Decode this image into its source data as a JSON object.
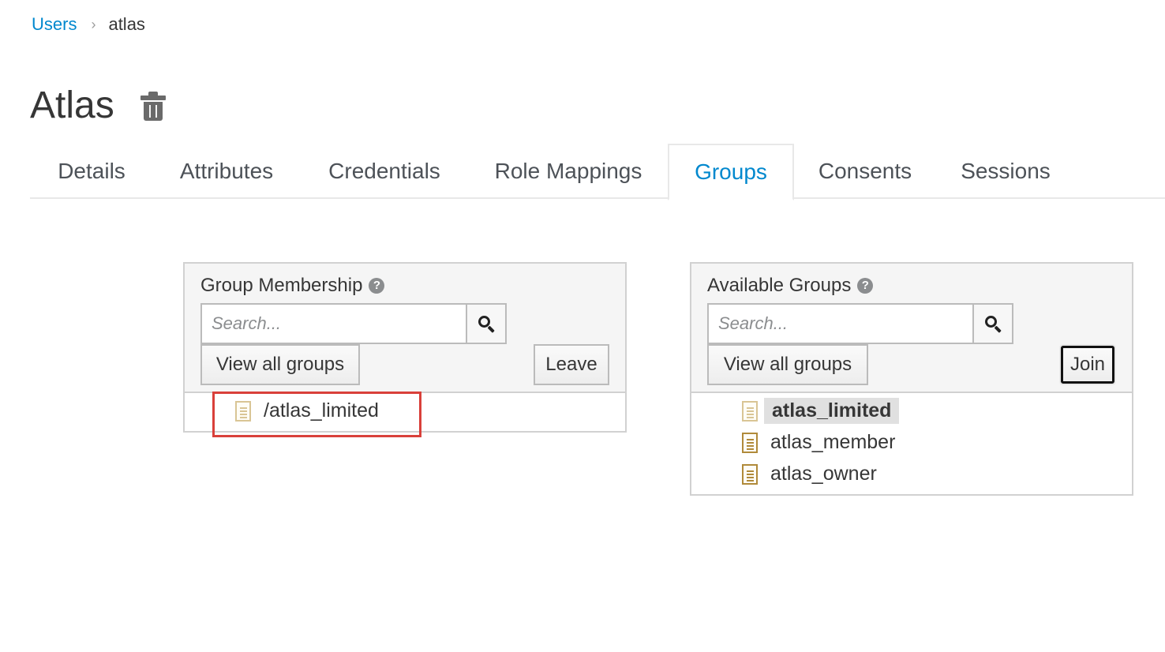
{
  "breadcrumb": {
    "parent": "Users",
    "separator": "›",
    "current": "atlas"
  },
  "page": {
    "title": "Atlas"
  },
  "tabs": [
    {
      "label": "Details",
      "active": false
    },
    {
      "label": "Attributes",
      "active": false
    },
    {
      "label": "Credentials",
      "active": false
    },
    {
      "label": "Role Mappings",
      "active": false
    },
    {
      "label": "Groups",
      "active": true
    },
    {
      "label": "Consents",
      "active": false
    },
    {
      "label": "Sessions",
      "active": false
    }
  ],
  "membership": {
    "title": "Group Membership",
    "search_placeholder": "Search...",
    "view_all_label": "View all groups",
    "action_label": "Leave",
    "items": [
      {
        "label": "/atlas_limited"
      }
    ]
  },
  "available": {
    "title": "Available Groups",
    "search_placeholder": "Search...",
    "view_all_label": "View all groups",
    "action_label": "Join",
    "items": [
      {
        "label": "atlas_limited",
        "selected": true
      },
      {
        "label": "atlas_member",
        "selected": false
      },
      {
        "label": "atlas_owner",
        "selected": false
      }
    ]
  },
  "colors": {
    "link": "#0088ce",
    "annotation": "#d9403a"
  }
}
